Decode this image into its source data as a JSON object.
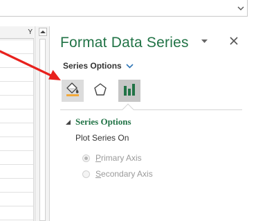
{
  "formula_bar": {
    "value": ""
  },
  "grid": {
    "column_letter": "Y"
  },
  "pane": {
    "title": "Format Data Series",
    "series_dropdown_label": "Series Options",
    "tabs": [
      {
        "name": "Fill & Line",
        "icon": "paint-bucket-icon",
        "selected": false
      },
      {
        "name": "Effects",
        "icon": "pentagon-icon",
        "selected": false
      },
      {
        "name": "Series Options",
        "icon": "bar-chart-icon",
        "selected": true
      }
    ],
    "section": {
      "title": "Series Options",
      "expanded": true,
      "plot_label": "Plot Series On",
      "options": [
        {
          "access_key": "P",
          "rest": "rimary Axis",
          "checked": true,
          "enabled": false
        },
        {
          "access_key": "S",
          "rest": "econdary Axis",
          "checked": false,
          "enabled": false
        }
      ]
    }
  },
  "colors": {
    "accent_green": "#217346",
    "annotation_red": "#e8211d",
    "disabled_text": "#9a9a9a"
  }
}
